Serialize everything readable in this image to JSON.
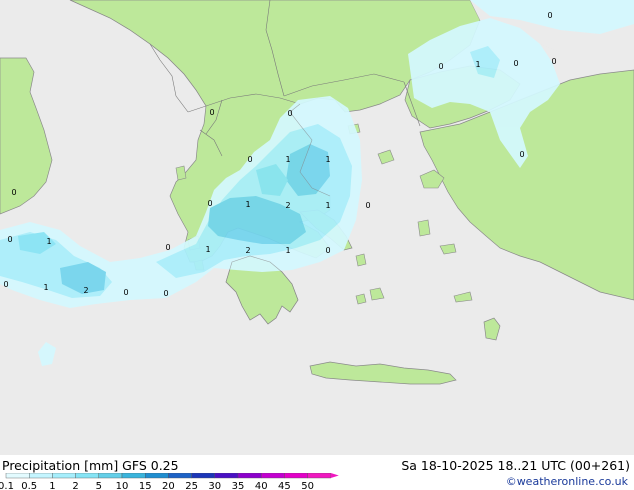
{
  "footer": {
    "title": "Precipitation [mm]  GFS 0.25",
    "datetime": "Sa 18-10-2025 18..21 UTC (00+261)",
    "credit": "©weatheronline.co.uk"
  },
  "legend": {
    "labels": [
      "0.1",
      "0.5",
      "1",
      "2",
      "5",
      "10",
      "15",
      "20",
      "25",
      "30",
      "35",
      "40",
      "45",
      "50"
    ],
    "colors": [
      "#e3fbff",
      "#c4f5ff",
      "#a6eefc",
      "#86e4f5",
      "#64cfe8",
      "#3ab4dc",
      "#1f8ed0",
      "#1d62c6",
      "#1c36b8",
      "#4a10c4",
      "#8c00cc",
      "#c300d0",
      "#e300c8",
      "#f018c0"
    ]
  },
  "map": {
    "colors": {
      "sea": "#ebebeb",
      "land": "#bde89a",
      "coast": "#8a8a8a",
      "border": "#7a7a7a",
      "precip_light": "#d4f9ff",
      "precip_mid": "#a9effc",
      "precip_heavy": "#72d5ee"
    },
    "value_labels": [
      {
        "id": "v1",
        "text": "0"
      },
      {
        "id": "v2",
        "text": "1"
      },
      {
        "id": "v3",
        "text": "0"
      },
      {
        "id": "v4",
        "text": "0"
      },
      {
        "id": "v5",
        "text": "0"
      },
      {
        "id": "v6",
        "text": "0"
      },
      {
        "id": "v7",
        "text": "0"
      },
      {
        "id": "v8",
        "text": "1"
      },
      {
        "id": "v9",
        "text": "1"
      },
      {
        "id": "v10",
        "text": "0"
      },
      {
        "id": "v11",
        "text": "1"
      },
      {
        "id": "v12",
        "text": "2"
      },
      {
        "id": "v13",
        "text": "1"
      },
      {
        "id": "v14",
        "text": "0"
      },
      {
        "id": "v15",
        "text": "0"
      },
      {
        "id": "v16",
        "text": "1"
      },
      {
        "id": "v17",
        "text": "2"
      },
      {
        "id": "v18",
        "text": "1"
      },
      {
        "id": "v19",
        "text": "0"
      },
      {
        "id": "v20",
        "text": "0"
      },
      {
        "id": "v21",
        "text": "0"
      },
      {
        "id": "v22",
        "text": "1"
      },
      {
        "id": "v23",
        "text": "0"
      },
      {
        "id": "v24",
        "text": "1"
      },
      {
        "id": "v25",
        "text": "2"
      },
      {
        "id": "v26",
        "text": "0"
      },
      {
        "id": "v27",
        "text": "0"
      },
      {
        "id": "v28",
        "text": "0"
      },
      {
        "id": "v29",
        "text": "0"
      }
    ]
  }
}
